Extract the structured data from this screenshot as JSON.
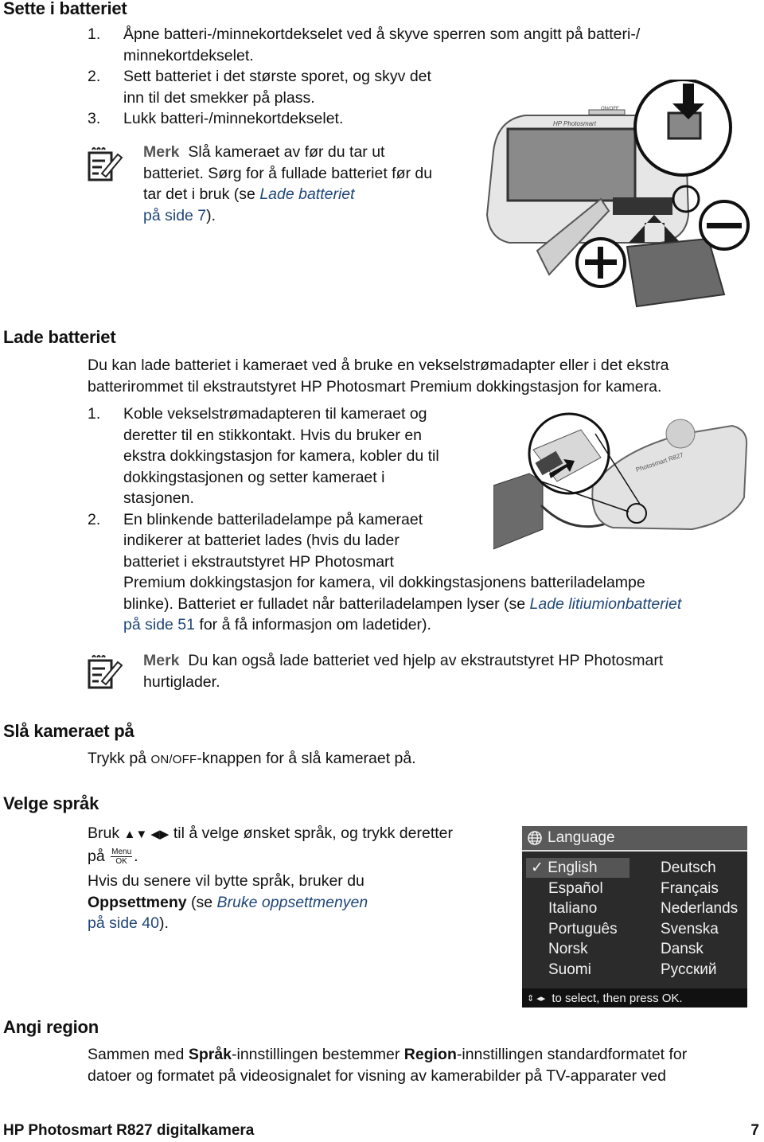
{
  "sections": {
    "insert": {
      "heading": "Sette i batteriet",
      "steps": [
        {
          "n": "1.",
          "lines": [
            "Åpne batteri-/minnekortdekselet ved å skyve sperren som angitt på batteri-/",
            "minnekortdekselet."
          ]
        },
        {
          "n": "2.",
          "lines": [
            "Sett batteriet i det største sporet, og skyv det",
            "inn til det smekker på plass."
          ]
        },
        {
          "n": "3.",
          "lines": [
            "Lukk batteri-/minnekortdekselet."
          ]
        }
      ],
      "note": {
        "label": "Merk",
        "line1": "Slå kameraet av før du tar ut",
        "line2": "batteriet. Sørg for å fullade batteriet før du",
        "line3_pre": "tar det i bruk (se ",
        "link1": "Lade batteriet",
        "link2": "på side 7",
        "line4_post": ")."
      },
      "figure": {
        "brand": "HP Photosmart",
        "button": "ON/OFF"
      }
    },
    "charge": {
      "heading": "Lade batteriet",
      "intro": [
        "Du kan lade batteriet i kameraet ved å bruke en vekselstrømadapter eller i det ekstra",
        "batterirommet til ekstrautstyret HP Photosmart Premium dokkingstasjon for kamera."
      ],
      "steps": [
        {
          "n": "1.",
          "lines": [
            "Koble vekselstrømadapteren til kameraet og",
            "deretter til en stikkontakt. Hvis du bruker en",
            "ekstra dokkingstasjon for kamera, kobler du til",
            "dokkingstasjonen og setter kameraet i",
            "stasjonen."
          ]
        },
        {
          "n": "2.",
          "lines": [
            "En blinkende batteriladelampe på kameraet",
            "indikerer at batteriet lades (hvis du lader",
            "batteriet i ekstrautstyret HP Photosmart",
            "Premium dokkingstasjon for kamera, vil dokkingstasjonens batteriladelampe"
          ],
          "line5_pre": "blinke). Batteriet er fulladet når batteriladelampen lyser (se ",
          "link1": "Lade litiumionbatteriet",
          "link2": "på side 51",
          "line6_post": " for å få informasjon om ladetider)."
        }
      ],
      "note": {
        "label": "Merk",
        "line1": "Du kan også lade batteriet ved hjelp av ekstrautstyret HP Photosmart",
        "line2": "hurtiglader."
      },
      "figure": {
        "model": "Photosmart R827"
      }
    },
    "power_on": {
      "heading": "Slå kameraet på",
      "pre": "Trykk på ",
      "button": "ON/OFF",
      "post": "-knappen for å slå kameraet på."
    },
    "language": {
      "heading": "Velge språk",
      "line1_pre": "Bruk ",
      "arrows": "▲▼ ◀▶",
      "line1_post": " til å velge ønsket språk, og trykk deretter",
      "line2_pre": "på ",
      "menu_top": "Menu",
      "menu_bottom": "OK",
      "line2_post": ".",
      "p2_line1": "Hvis du senere vil bytte språk, bruker du",
      "p2_bold": "Oppsettmeny",
      "p2_mid": " (se ",
      "p2_link1": "Bruke oppsettmenyen",
      "p2_link2": "på side 40",
      "p2_post": ").",
      "screen": {
        "title": "Language",
        "selected": "English",
        "left": [
          "English",
          "Español",
          "Italiano",
          "Português",
          "Norsk",
          "Suomi"
        ],
        "right": [
          "Deutsch",
          "Français",
          "Nederlands",
          "Svenska",
          "Dansk",
          "Русский"
        ],
        "footer": "to select, then press OK."
      }
    },
    "region": {
      "heading": "Angi region",
      "pre": "Sammen med ",
      "bold1": "Språk",
      "mid": "-innstillingen bestemmer ",
      "bold2": "Region",
      "post": "-innstillingen standardformatet for",
      "line2": "datoer og formatet på videosignalet for visning av kamerabilder på TV-apparater ved"
    }
  },
  "footer": {
    "title": "HP Photosmart R827 digitalkamera",
    "page": "7"
  }
}
